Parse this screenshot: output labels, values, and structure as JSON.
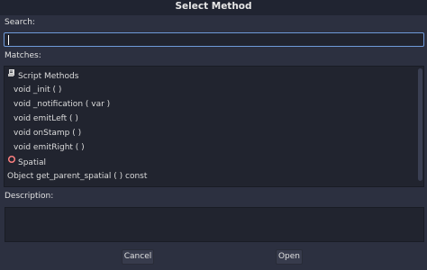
{
  "window": {
    "title": "Select Method"
  },
  "search": {
    "label": "Search:",
    "value": ""
  },
  "matches": {
    "label": "Matches:",
    "rows": [
      {
        "type": "category",
        "icon": "script-icon",
        "text": "Script Methods"
      },
      {
        "type": "method",
        "text": "void  _init ( )"
      },
      {
        "type": "method",
        "text": "void  _notification ( var  )"
      },
      {
        "type": "method",
        "text": "void  emitLeft ( )"
      },
      {
        "type": "method",
        "text": "void  onStamp ( )"
      },
      {
        "type": "method",
        "text": "void  emitRight ( )"
      },
      {
        "type": "category",
        "icon": "spatial-node-icon",
        "text": "Spatial"
      },
      {
        "type": "method",
        "text": "Object get_parent_spatial ( ) const"
      }
    ]
  },
  "description": {
    "label": "Description:"
  },
  "buttons": {
    "cancel": "Cancel",
    "open": "Open"
  },
  "colors": {
    "accent": "#6f9ad9",
    "spatial_icon": "#fc7f7f",
    "background": "#2c3040"
  }
}
